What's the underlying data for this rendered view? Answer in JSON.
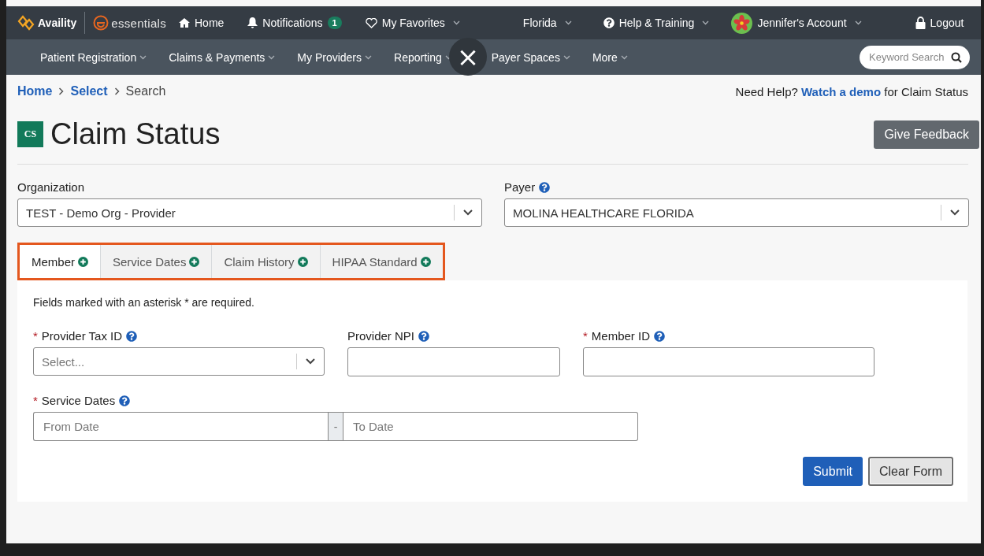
{
  "top_nav": {
    "brand": "Availity",
    "product": "essentials",
    "items": [
      {
        "kind": "home",
        "label": "Home",
        "dropdown": false
      },
      {
        "kind": "notifications",
        "label": "Notifications",
        "badge": "1",
        "dropdown": false
      },
      {
        "kind": "favorites",
        "label": "My Favorites",
        "dropdown": true
      },
      {
        "kind": "region",
        "label": "Florida",
        "dropdown": true
      },
      {
        "kind": "help",
        "label": "Help & Training",
        "dropdown": true
      },
      {
        "kind": "account",
        "label": "Jennifer's Account",
        "dropdown": true
      },
      {
        "kind": "logout",
        "label": "Logout",
        "dropdown": false
      }
    ]
  },
  "main_nav": {
    "items": [
      "Patient Registration",
      "Claims & Payments",
      "My Providers",
      "Reporting",
      "Payer Spaces",
      "More"
    ],
    "search": {
      "placeholder": "Keyword Search"
    }
  },
  "breadcrumbs": [
    {
      "label": "Home",
      "link": true
    },
    {
      "label": "Select",
      "link": true
    },
    {
      "label": "Search",
      "link": false
    }
  ],
  "help": {
    "prefix": "Need Help?",
    "link": "Watch a demo",
    "suffix": "for Claim Status"
  },
  "page": {
    "icon_text": "CS",
    "title": "Claim Status",
    "feedback_button": "Give Feedback"
  },
  "selectors": [
    {
      "label": "Organization",
      "help": false,
      "value": "TEST - Demo Org - Provider"
    },
    {
      "label": "Payer",
      "help": true,
      "value": "MOLINA HEALTHCARE FLORIDA"
    }
  ],
  "tabs": [
    {
      "label": "Member",
      "selected": true
    },
    {
      "label": "Service Dates",
      "selected": false
    },
    {
      "label": "Claim History",
      "selected": false
    },
    {
      "label": "HIPAA Standard",
      "selected": false
    }
  ],
  "form": {
    "note": "Fields marked with an asterisk * are required.",
    "rows": [
      [
        {
          "kind": "select",
          "required_mark": "*",
          "label": "Provider Tax ID",
          "placeholder": "Select..."
        },
        {
          "kind": "text",
          "label": "Provider NPI"
        },
        {
          "kind": "text",
          "required_mark": "*",
          "label": "Member ID"
        }
      ],
      [
        {
          "kind": "daterange",
          "required_mark": "*",
          "label": "Service Dates",
          "placeholder": "From Date",
          "separator": "-",
          "placeholder_end": "To Date"
        }
      ]
    ],
    "buttons": [
      {
        "kind": "primary",
        "label": "Submit"
      },
      {
        "kind": "secondary",
        "label": "Clear Form"
      }
    ]
  },
  "overlay": {
    "close": "×"
  }
}
